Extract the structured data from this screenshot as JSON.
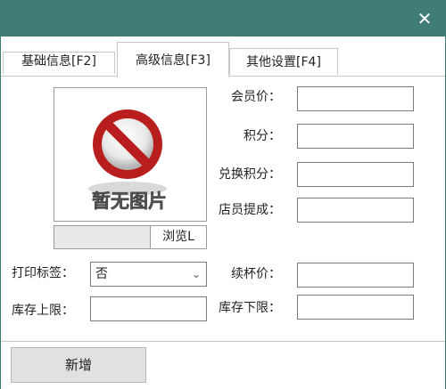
{
  "window": {
    "close_glyph": "✕",
    "title_color": "#3e7c75"
  },
  "tabs": [
    {
      "label": "基础信息[F2]"
    },
    {
      "label": "高级信息[F3]"
    },
    {
      "label": "其他设置[F4]"
    }
  ],
  "image": {
    "placeholder_text": "暂无图片"
  },
  "browse_label": "浏览L",
  "fields": {
    "member_price": {
      "label": "会员价：",
      "value": ""
    },
    "points": {
      "label": "积分：",
      "value": ""
    },
    "redeem_points": {
      "label": "兑换积分：",
      "value": ""
    },
    "staff_commission": {
      "label": "店员提成：",
      "value": ""
    },
    "refill_price": {
      "label": "续杯价：",
      "value": ""
    },
    "stock_upper": {
      "label": "库存上限：",
      "value": ""
    },
    "stock_lower": {
      "label": "库存下限：",
      "value": ""
    }
  },
  "print_label": {
    "label": "打印标签：",
    "selected": "否"
  },
  "footer": {
    "add_label": "新增"
  }
}
